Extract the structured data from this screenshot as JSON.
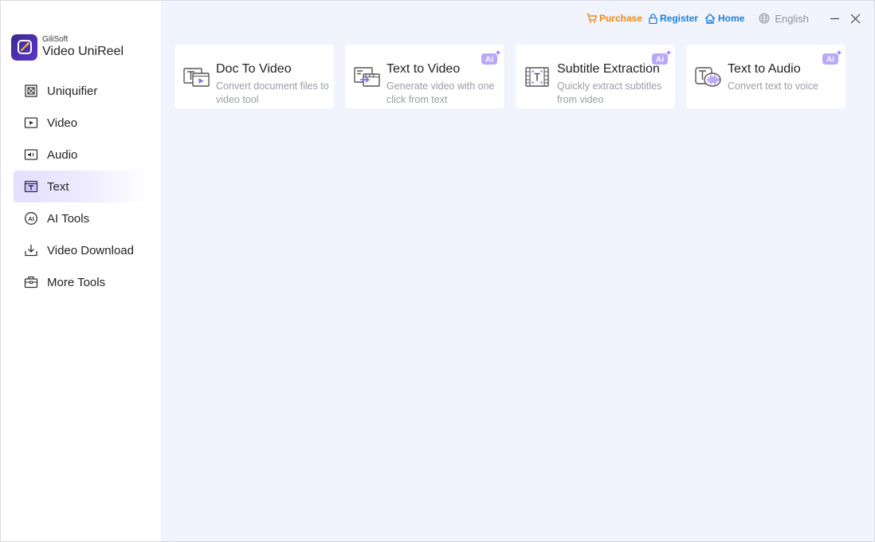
{
  "brand": {
    "company": "GiliSoft",
    "product": "Video UniReel"
  },
  "sidebar": {
    "items": [
      {
        "label": "Uniquifier",
        "icon": "uniquifier-icon"
      },
      {
        "label": "Video",
        "icon": "video-icon"
      },
      {
        "label": "Audio",
        "icon": "audio-icon"
      },
      {
        "label": "Text",
        "icon": "text-icon",
        "active": true
      },
      {
        "label": "AI Tools",
        "icon": "ai-icon"
      },
      {
        "label": "Video Download",
        "icon": "download-icon"
      },
      {
        "label": "More Tools",
        "icon": "toolbox-icon"
      }
    ]
  },
  "topbar": {
    "purchase": "Purchase",
    "register": "Register",
    "home": "Home",
    "language": "English"
  },
  "cards": [
    {
      "title": "Doc To Video",
      "desc": "Convert document files to video tool",
      "ai": false,
      "icon": "doc-to-video-icon"
    },
    {
      "title": "Text to Video",
      "desc": "Generate video with one click from text",
      "ai": true,
      "icon": "text-to-video-icon"
    },
    {
      "title": "Subtitle Extraction",
      "desc": "Quickly extract subtitles from video",
      "ai": true,
      "icon": "subtitle-extraction-icon"
    },
    {
      "title": "Text to Audio",
      "desc": "Convert text to voice",
      "ai": true,
      "icon": "text-to-audio-icon"
    }
  ],
  "ai_badge_label": "Ai",
  "colors": {
    "accent": "#7b5cf0",
    "purchase": "#f08a12",
    "link": "#1e7fd8",
    "background": "#f1f3fd",
    "active_nav": "#e3dfff"
  }
}
